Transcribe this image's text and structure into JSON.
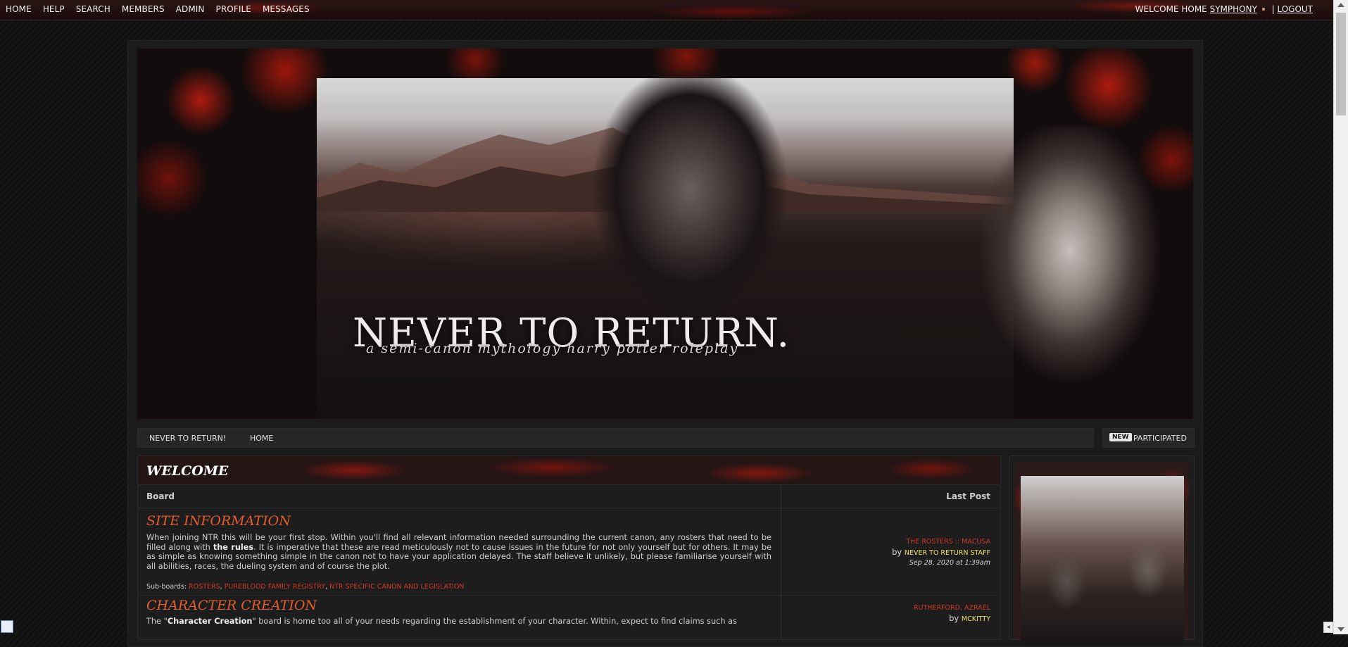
{
  "topnav": {
    "items": [
      "HOME",
      "HELP",
      "SEARCH",
      "MEMBERS",
      "ADMIN",
      "PROFILE",
      "MESSAGES"
    ]
  },
  "user": {
    "welcome_prefix": "WELCOME HOME",
    "username": "SYMPHONY",
    "separator": "|",
    "logout": "LOGOUT"
  },
  "banner": {
    "title": "NEVER TO RETURN.",
    "subtitle": "a semi-canon mythology harry potter roleplay"
  },
  "breadcrumb": {
    "items": [
      "NEVER TO RETURN!",
      "HOME"
    ]
  },
  "legend": {
    "new_tag": "NEW",
    "label": "PARTICIPATED"
  },
  "category": {
    "title": "WELCOME",
    "col_board": "Board",
    "col_last_post": "Last Post"
  },
  "forums": [
    {
      "name": "SITE INFORMATION",
      "description_parts": [
        "When joining NTR this will be your first stop. Within you'll find all relevant information needed surrounding the current canon, any rosters that need to be filled along with ",
        "the rules",
        ". It is imperative that these are read meticulously not to cause issues in the future for not only yourself but for others. It may be as simple as knowing something simple in the canon not to have your application delayed. The staff believe it unlikely, but please familiarise yourself with all abilities, races, the dueling system and of course the plot."
      ],
      "subboards_label": "Sub-boards:",
      "subboards": [
        "ROSTERS",
        "PUREBLOOD FAMILY REGISTRY",
        "NTR SPECIFIC CANON AND LEGISLATION"
      ],
      "last_post": {
        "thread": "THE ROSTERS :: MACUSA",
        "by": "by",
        "user": "NEVER TO RETURN STAFF",
        "date": "Sep 28, 2020 at 1:39am"
      }
    },
    {
      "name": "CHARACTER CREATION",
      "description_parts": [
        "The \"",
        "Character Creation",
        "\" board is home too all of your needs regarding the establishment of your character. Within, expect to find claims such as"
      ],
      "last_post": {
        "thread": "RUTHERFORD, AZRAEL",
        "by": "by",
        "user": "MCKITTY"
      }
    }
  ],
  "icons": {
    "scroll_up": "triangle-up",
    "scroll_down": "triangle-down",
    "h_scroll_left": "◂",
    "corner": "translate-icon"
  },
  "colors": {
    "forum_title": "#e15d2e",
    "thread_link": "#cc3a24",
    "username": "#f0e070"
  }
}
